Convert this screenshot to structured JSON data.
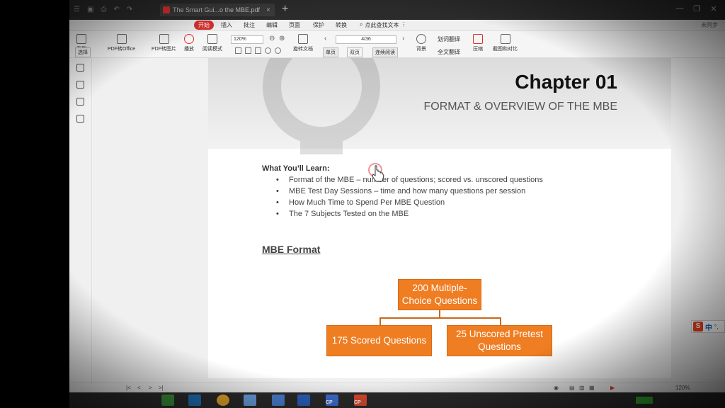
{
  "tab": {
    "title": "The Smart Gui...o the MBE.pdf"
  },
  "menu": {
    "items": [
      "开始",
      "插入",
      "批注",
      "编辑",
      "页面",
      "保护",
      "转换"
    ],
    "search": "点此查找文本",
    "sync": "未同步"
  },
  "toolbar": {
    "zoom": "120%",
    "page": "4/36",
    "tools": [
      {
        "label": "PDF转Office"
      },
      {
        "label": "PDF转图片"
      },
      {
        "label": "播放"
      },
      {
        "label": "阅读模式"
      },
      {
        "label": "旋转文档"
      },
      {
        "label": "背景"
      },
      {
        "label": "全文翻译"
      },
      {
        "label": "压缩"
      },
      {
        "label": "截图和对比"
      }
    ],
    "view_single": "单页",
    "view_double": "双页",
    "view_continuous": "连续阅读",
    "translate": "划词翻译",
    "hand": "手型",
    "select": "选择"
  },
  "document": {
    "chapter": "Chapter 01",
    "subtitle": "FORMAT & OVERVIEW OF THE MBE",
    "learn_title": "What You’ll Learn:",
    "bullets": [
      "Format of the MBE – number of questions; scored vs. unscored questions",
      "MBE Test Day Sessions – time and how many questions per session",
      "How Much Time to Spend Per MBE Question",
      "The 7 Subjects Tested on the MBE"
    ],
    "section": "MBE Format",
    "diagram": {
      "top": "200 Multiple-Choice Questions",
      "left": "175 Scored Questions",
      "right": "25 Unscored Pretest Questions",
      "color": "#ef7d22"
    }
  },
  "status": {
    "zoom": "120%"
  },
  "taskbar": {
    "apps": [
      "CP",
      "CP"
    ]
  },
  "ime": {
    "logo": "S",
    "lang": "中"
  }
}
